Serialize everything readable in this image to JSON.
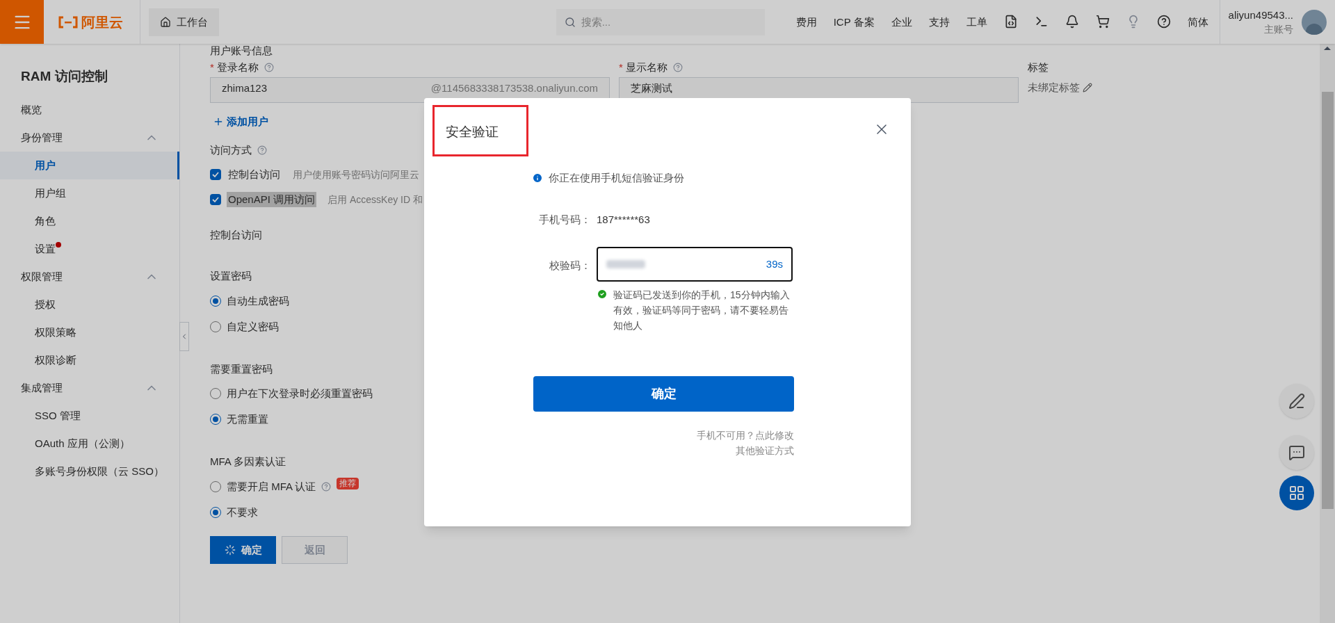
{
  "top_bar": {
    "logo": "阿里云",
    "workbench": "工作台",
    "search": {
      "placeholder": "搜索..."
    },
    "links": [
      "费用",
      "ICP 备案",
      "企业",
      "支持",
      "工单"
    ],
    "language": "简体",
    "account": {
      "name": "aliyun49543...",
      "type": "主账号"
    }
  },
  "sidebar": {
    "title": "RAM 访问控制",
    "items": [
      {
        "label": "概览",
        "selected": false
      },
      {
        "label": "身份管理",
        "expanded": true,
        "children": [
          {
            "label": "用户",
            "selected": true,
            "dot": false
          },
          {
            "label": "用户组",
            "selected": false,
            "dot": false
          },
          {
            "label": "角色",
            "selected": false,
            "dot": false
          },
          {
            "label": "设置",
            "selected": false,
            "dot": true
          }
        ]
      },
      {
        "label": "权限管理",
        "expanded": true,
        "children": [
          {
            "label": "授权",
            "selected": false,
            "dot": false
          },
          {
            "label": "权限策略",
            "selected": false,
            "dot": false
          },
          {
            "label": "权限诊断",
            "selected": false,
            "dot": false
          }
        ]
      },
      {
        "label": "集成管理",
        "expanded": true,
        "children": [
          {
            "label": "SSO 管理",
            "selected": false,
            "dot": false
          },
          {
            "label": "OAuth 应用（公测）",
            "selected": false,
            "dot": false
          },
          {
            "label": "多账号身份权限（云 SSO）",
            "selected": false,
            "dot": false
          }
        ]
      }
    ]
  },
  "form": {
    "section_title": "用户账号信息",
    "login_name": {
      "marker": "*",
      "label": "登录名称",
      "value": "zhima123",
      "suffix": "@1145683338173538.onaliyun.com"
    },
    "display_name": {
      "marker": "*",
      "label": "显示名称",
      "value": "芝麻测试"
    },
    "tags": {
      "label": "标签",
      "value": "未绑定标签"
    },
    "add_user": "添加用户",
    "access": {
      "label": "访问方式",
      "options": [
        {
          "label": "控制台访问",
          "description": "用户使用账号密码访问阿里云",
          "checked": true,
          "highlighted": false
        },
        {
          "label": "OpenAPI 调用访问",
          "description": "启用 AccessKey ID 和",
          "checked": true,
          "highlighted": true
        }
      ]
    },
    "console_access_title": "控制台访问",
    "groups": [
      {
        "title": "设置密码",
        "options": [
          {
            "label": "自动生成密码",
            "selected": true
          },
          {
            "label": "自定义密码",
            "selected": false
          }
        ]
      },
      {
        "title": "需要重置密码",
        "options": [
          {
            "label": "用户在下次登录时必须重置密码",
            "selected": false
          },
          {
            "label": "无需重置",
            "selected": true
          }
        ]
      },
      {
        "title": "MFA 多因素认证",
        "options": [
          {
            "label": "需要开启 MFA 认证",
            "selected": false,
            "help": true,
            "badge": "推荐"
          },
          {
            "label": "不要求",
            "selected": true
          }
        ]
      }
    ],
    "confirm": {
      "label": "确定",
      "loading": true
    },
    "back": {
      "label": "返回",
      "disabled": true
    }
  },
  "dialog": {
    "title": "安全验证",
    "title_highlighted": true,
    "notice": "你正在使用手机短信验证身份",
    "phone": {
      "label": "手机号码：",
      "value": "187******63"
    },
    "code": {
      "label": "校验码：",
      "countdown": "39s",
      "focused": true
    },
    "sent_hint": "验证码已发送到你的手机，15分钟内输入有效，验证码等同于密码，请不要轻易告知他人",
    "confirm": "确定",
    "links": [
      "手机不可用？点此修改",
      "其他验证方式"
    ]
  }
}
